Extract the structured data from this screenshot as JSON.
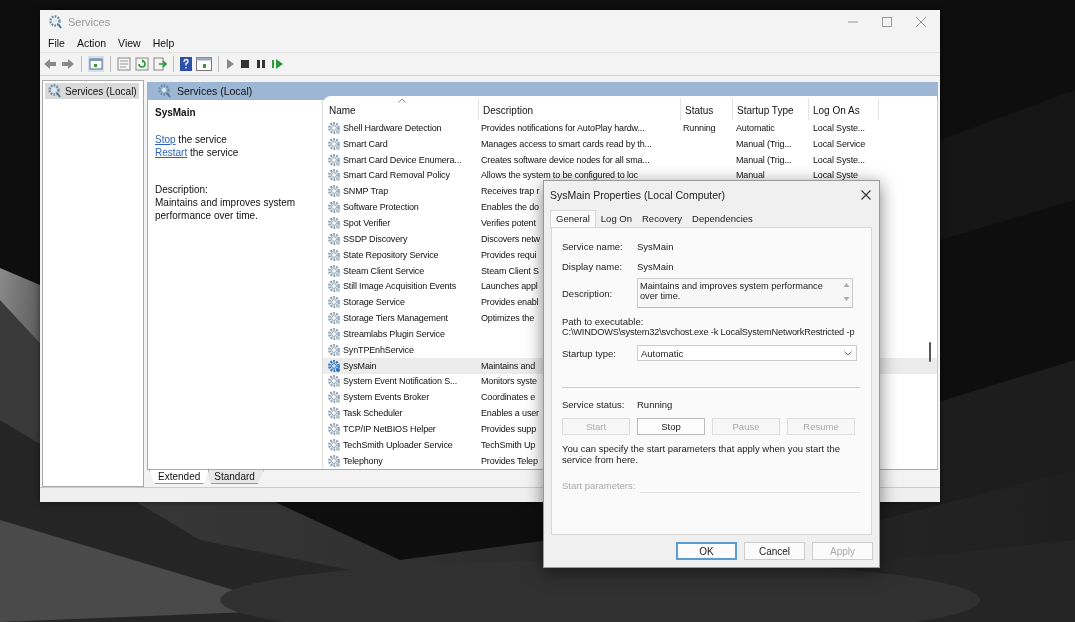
{
  "window": {
    "title": "Services"
  },
  "menu": [
    "File",
    "Action",
    "View",
    "Help"
  ],
  "tree": {
    "items": [
      {
        "label": "Services (Local)",
        "selected": true
      }
    ]
  },
  "header": {
    "title": "Services (Local)"
  },
  "details": {
    "title": "SysMain",
    "actions": [
      {
        "link": "Stop",
        "text": " the service"
      },
      {
        "link": "Restart",
        "text": " the service"
      }
    ],
    "description_label": "Description:",
    "description": "Maintains and improves system performance over time."
  },
  "table": {
    "columns": [
      {
        "label": "Name",
        "sorted": true
      },
      {
        "label": "Description",
        "sorted": false
      },
      {
        "label": "Status",
        "sorted": false
      },
      {
        "label": "Startup Type",
        "sorted": false
      },
      {
        "label": "Log On As",
        "sorted": false
      }
    ],
    "rows": [
      {
        "name": "Shell Hardware Detection",
        "description": "Provides notifications for AutoPlay hardw...",
        "status": "Running",
        "startup_type": "Automatic",
        "log_on_as": "Local Syste...",
        "selected": false
      },
      {
        "name": "Smart Card",
        "description": "Manages access to smart cards read by th...",
        "startup_type": "Manual (Trig...",
        "log_on_as": "Local Service",
        "selected": false
      },
      {
        "name": "Smart Card Device Enumera...",
        "description": "Creates software device nodes for all sma...",
        "startup_type": "Manual (Trig...",
        "log_on_as": "Local Syste...",
        "selected": false
      },
      {
        "name": "Smart Card Removal Policy",
        "description": "Allows the system to be configured to loc",
        "startup_type": "Manual",
        "log_on_as": "Local Syste",
        "selected": false
      },
      {
        "name": "SNMP Trap",
        "description": "Receives trap r",
        "selected": false
      },
      {
        "name": "Software Protection",
        "description": "Enables the do",
        "selected": false
      },
      {
        "name": "Spot Verifier",
        "description": "Verifies potent",
        "selected": false
      },
      {
        "name": "SSDP Discovery",
        "description": "Discovers netw",
        "selected": false
      },
      {
        "name": "State Repository Service",
        "description": "Provides requi",
        "selected": false
      },
      {
        "name": "Steam Client Service",
        "description": "Steam Client S",
        "selected": false
      },
      {
        "name": "Still Image Acquisition Events",
        "description": "Launches appl",
        "selected": false
      },
      {
        "name": "Storage Service",
        "description": "Provides enabl",
        "selected": false
      },
      {
        "name": "Storage Tiers Management",
        "description": "Optimizes the",
        "selected": false
      },
      {
        "name": "Streamlabs Plugin Service",
        "selected": false
      },
      {
        "name": "SynTPEnhService",
        "selected": false
      },
      {
        "name": "SysMain",
        "description": "Maintains and",
        "selected": true
      },
      {
        "name": "System Event Notification S...",
        "description": "Monitors syste",
        "selected": false
      },
      {
        "name": "System Events Broker",
        "description": "Coordinates e",
        "selected": false
      },
      {
        "name": "Task Scheduler",
        "description": "Enables a user",
        "selected": false
      },
      {
        "name": "TCP/IP NetBIOS Helper",
        "description": "Provides supp",
        "selected": false
      },
      {
        "name": "TechSmith Uploader Service",
        "description": "TechSmith Up",
        "selected": false
      },
      {
        "name": "Telephony",
        "description": "Provides Telep",
        "selected": false
      }
    ]
  },
  "view_tabs": [
    {
      "label": "Extended",
      "selected": true
    },
    {
      "label": "Standard",
      "selected": false
    }
  ],
  "dialog": {
    "title": "SysMain Properties (Local Computer)",
    "tabs": [
      {
        "label": "General",
        "selected": true
      },
      {
        "label": "Log On",
        "selected": false
      },
      {
        "label": "Recovery",
        "selected": false
      },
      {
        "label": "Dependencies",
        "selected": false
      }
    ],
    "service_name": {
      "label": "Service name:",
      "value": "SysMain"
    },
    "display_name": {
      "label": "Display name:",
      "value": "SysMain"
    },
    "description": {
      "label": "Description:",
      "value": "Maintains and improves system performance over time."
    },
    "path": {
      "label": "Path to executable:",
      "value": "C:\\WINDOWS\\system32\\svchost.exe -k LocalSystemNetworkRestricted -p"
    },
    "startup_type": {
      "label": "Startup type:",
      "value": "Automatic"
    },
    "service_status": {
      "label": "Service status:",
      "value": "Running"
    },
    "service_buttons": [
      {
        "label": "Start",
        "disabled": true
      },
      {
        "label": "Stop",
        "disabled": false
      },
      {
        "label": "Pause",
        "disabled": true
      },
      {
        "label": "Resume",
        "disabled": true
      }
    ],
    "note": "You can specify the start parameters that apply when you start the service from here.",
    "start_parameters": {
      "label": "Start parameters:",
      "disabled": true
    },
    "buttons": [
      {
        "label": "OK",
        "default": true,
        "disabled": false
      },
      {
        "label": "Cancel",
        "default": false,
        "disabled": false
      },
      {
        "label": "Apply",
        "default": false,
        "disabled": true
      }
    ]
  }
}
